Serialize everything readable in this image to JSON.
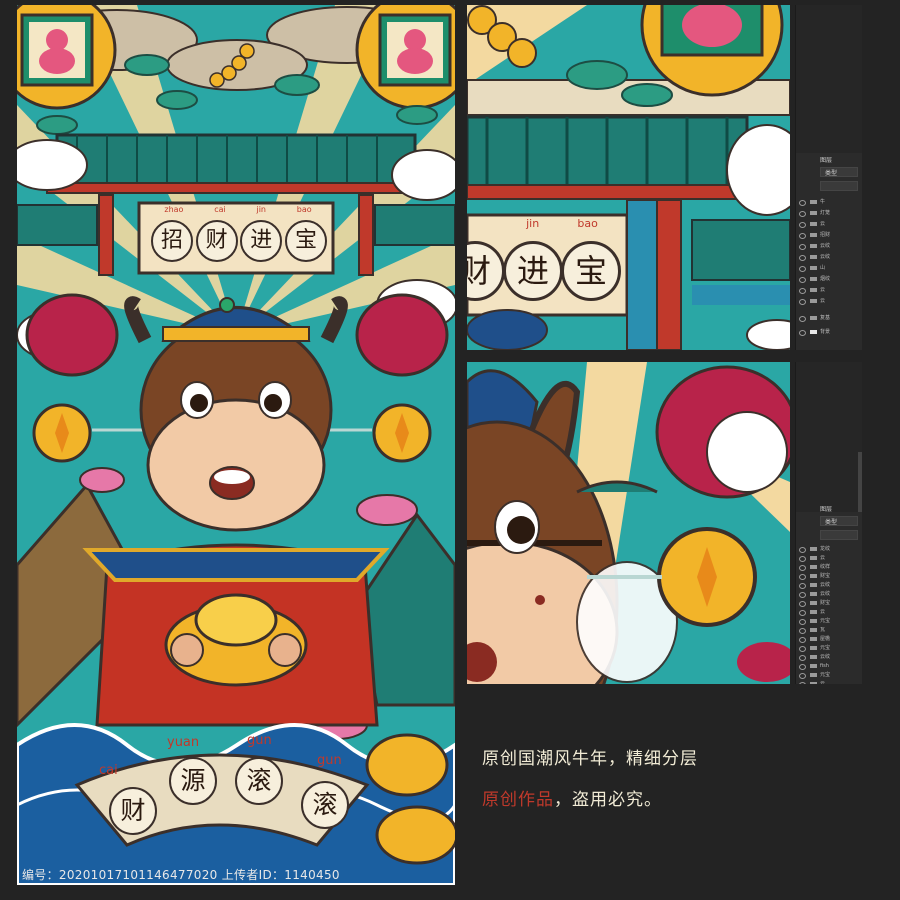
{
  "poster": {
    "top_plaque": {
      "chars": [
        "招",
        "财",
        "进",
        "宝"
      ],
      "pinyin": [
        "zhao",
        "cai",
        "jin",
        "bao"
      ]
    },
    "bottom_scroll": {
      "chars": [
        "财",
        "源",
        "滚",
        "滚"
      ],
      "pinyin": [
        "cai",
        "yuan",
        "gun",
        "gun"
      ]
    }
  },
  "crop_top": {
    "plaque_chars": [
      "财",
      "进",
      "宝"
    ],
    "plaque_pinyin": [
      "jin",
      "bao"
    ]
  },
  "layers_panel_top": {
    "tab": "图层",
    "filter": "类型",
    "layers": [
      "牛",
      "灯笼",
      "云",
      "招财",
      "云纹",
      "云纹",
      "山",
      "烟纹",
      "云",
      "云",
      "复基",
      "背景"
    ]
  },
  "layers_panel_bottom": {
    "tab": "图层",
    "filter": "类型",
    "layers": [
      "龙纹",
      "云",
      "纹样",
      "财宝",
      "云纹",
      "云纹",
      "财宝",
      "云",
      "元宝",
      "瓦",
      "屋檐",
      "元宝",
      "云纹",
      "fish",
      "元宝",
      "云"
    ]
  },
  "caption": {
    "line1": "原创国潮风牛年，精细分层",
    "line2_red": "原创作品",
    "line2_rest": "，盗用必究。"
  },
  "footer": {
    "text": "编号：20201017101146477020 上传者ID：1140450"
  },
  "colors": {
    "background": "#232323",
    "accent_red": "#c0392b",
    "caption": "#f2ecd6"
  }
}
